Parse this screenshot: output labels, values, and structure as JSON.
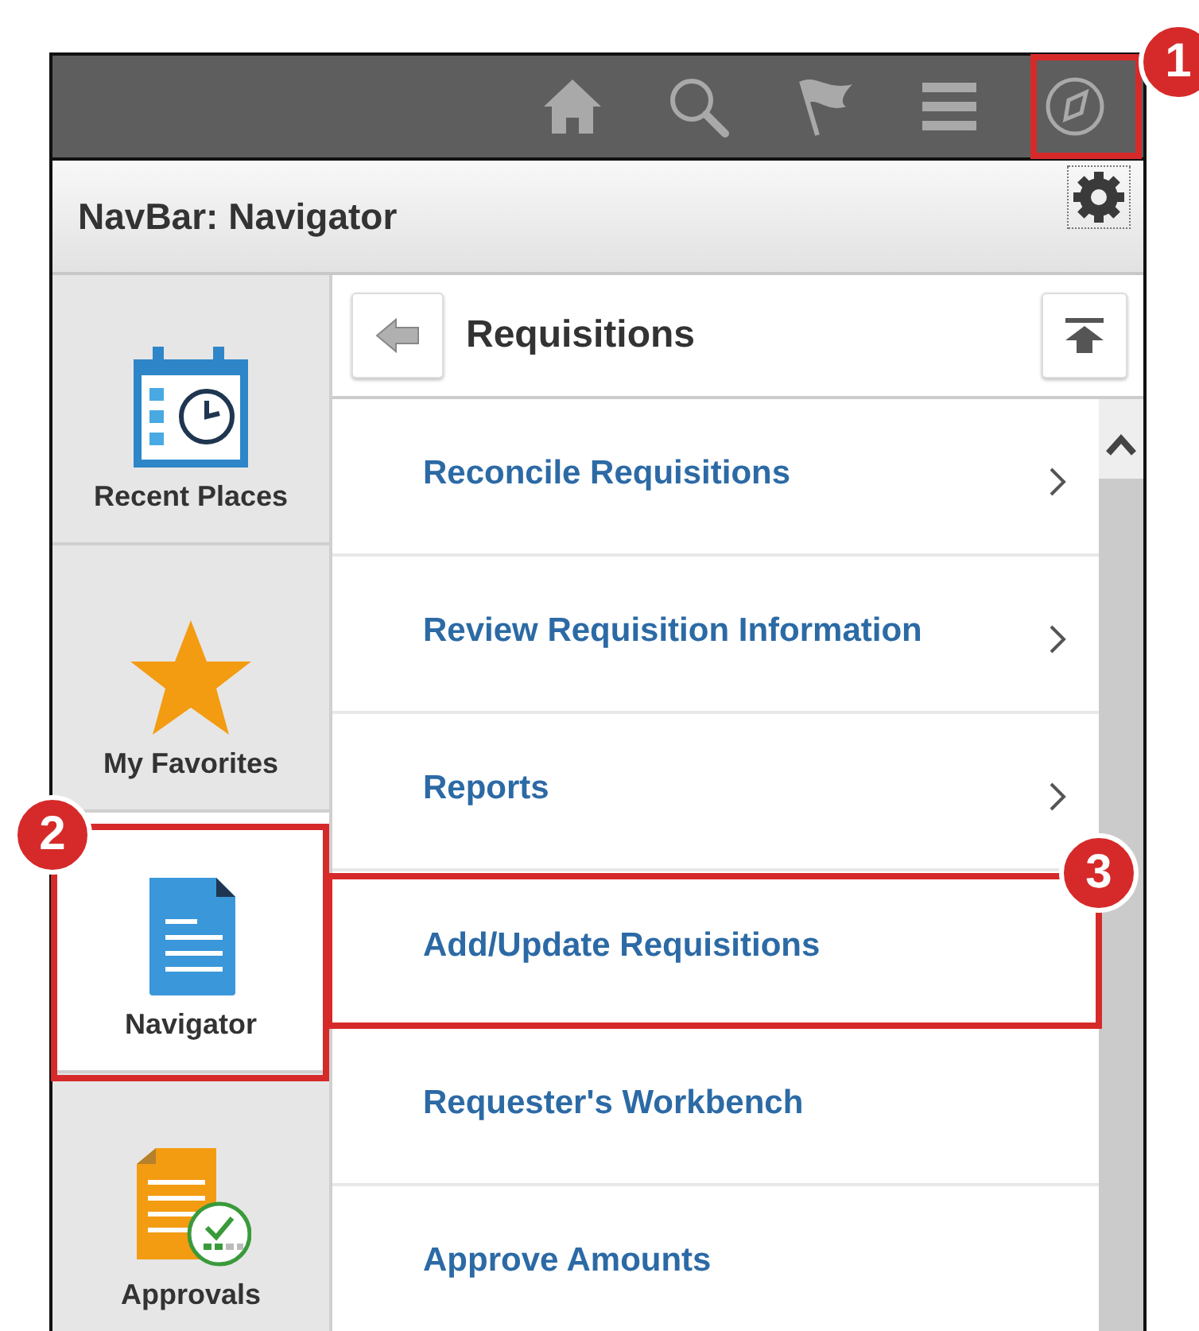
{
  "toolbar": {
    "buttons": [
      {
        "kind": "home"
      },
      {
        "kind": "search"
      },
      {
        "kind": "flag"
      },
      {
        "kind": "menu"
      },
      {
        "kind": "navigator"
      }
    ]
  },
  "title_bar": {
    "title": "NavBar: Navigator"
  },
  "sidebar": {
    "items": [
      {
        "label": "Recent Places",
        "kind": "recent",
        "selected": false
      },
      {
        "label": "My Favorites",
        "kind": "favorites",
        "selected": false
      },
      {
        "label": "Navigator",
        "kind": "navigator",
        "selected": true
      },
      {
        "label": "Approvals",
        "kind": "approvals",
        "selected": false
      }
    ]
  },
  "panel": {
    "title": "Requisitions",
    "items": [
      {
        "label": "Reconcile Requisitions",
        "has_submenu": true
      },
      {
        "label": "Review Requisition Information",
        "has_submenu": true
      },
      {
        "label": "Reports",
        "has_submenu": true
      },
      {
        "label": "Add/Update Requisitions",
        "has_submenu": false
      },
      {
        "label": "Requester's Workbench",
        "has_submenu": false
      },
      {
        "label": "Approve Amounts",
        "has_submenu": false
      }
    ]
  },
  "callouts": [
    {
      "number": "1",
      "kind": "toolbar"
    },
    {
      "number": "2",
      "kind": "sidebar"
    },
    {
      "number": "3",
      "kind": "row"
    }
  ]
}
